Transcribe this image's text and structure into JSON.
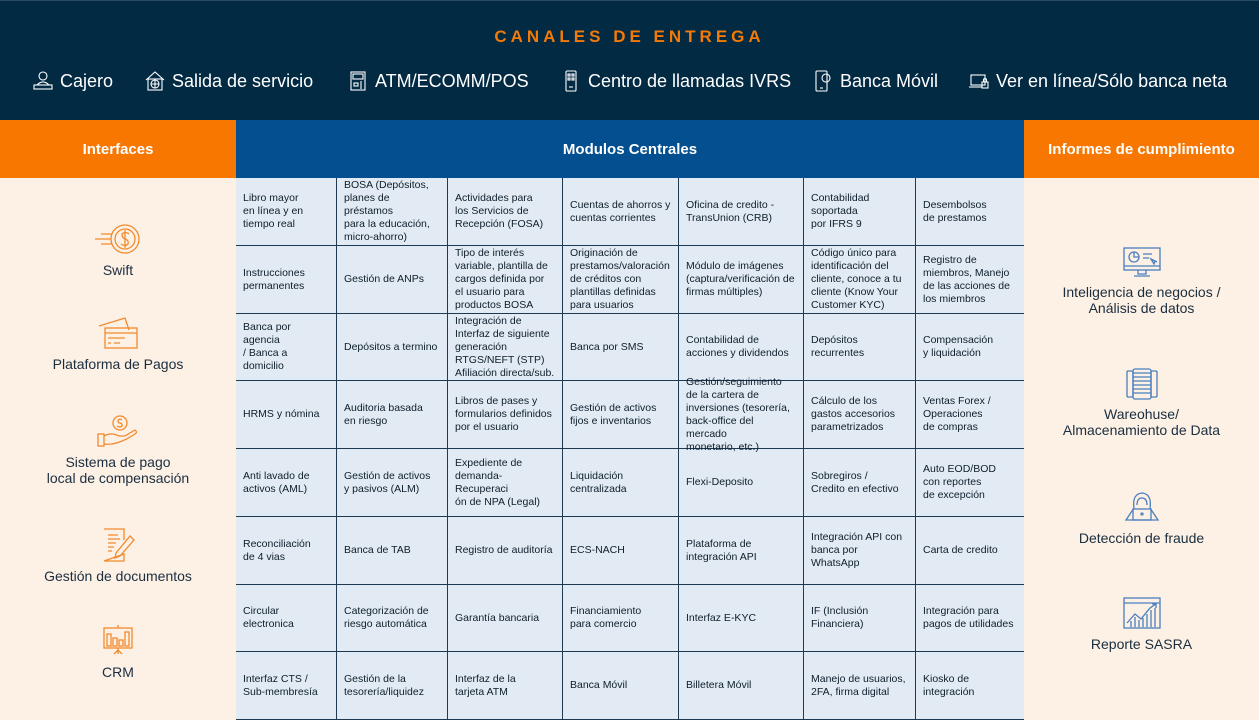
{
  "header": {
    "title": "CANALES DE ENTREGA",
    "channels": [
      {
        "label": "Cajero",
        "icon": "cashier-icon"
      },
      {
        "label": "Salida de servicio",
        "icon": "service-outlet-icon"
      },
      {
        "label": "ATM/ECOMM/POS",
        "icon": "atm-icon"
      },
      {
        "label": "Centro de llamadas IVRS",
        "icon": "phone-keypad-icon"
      },
      {
        "label": "Banca Móvil",
        "icon": "mobile-banking-icon"
      },
      {
        "label": "Ver en línea/Sólo banca neta",
        "icon": "laptop-lock-icon"
      }
    ]
  },
  "columns": {
    "left": "Interfaces",
    "middle": "Modulos Centrales",
    "right": "Informes de cumplimiento"
  },
  "interfaces": [
    {
      "label": "Swift",
      "icon": "coin-speed-icon"
    },
    {
      "label": "Plataforma de Pagos",
      "icon": "credit-cards-icon"
    },
    {
      "label": "Sistema de pago\nlocal de compensación",
      "icon": "hand-coin-icon"
    },
    {
      "label": "Gestión de documentos",
      "icon": "document-pencil-icon"
    },
    {
      "label": "CRM",
      "icon": "presentation-chart-icon"
    }
  ],
  "compliance": [
    {
      "label": "Inteligencia de negocios /\nAnálisis de datos",
      "icon": "monitor-pie-chart-icon"
    },
    {
      "label": "Wareohuse/\nAlmacenamiento de Data",
      "icon": "server-rack-icon"
    },
    {
      "label": "Detección de fraude",
      "icon": "hacker-laptop-icon"
    },
    {
      "label": "Reporte SASRA",
      "icon": "growth-chart-icon"
    }
  ],
  "modules": [
    [
      "Libro mayor\nen línea y en\ntiempo real",
      "BOSA (Depósitos,\nplanes de préstamos\npara la educación,\nmicro-ahorro)",
      "Actividades para\nlos Servicios de\nRecepción (FOSA)",
      "Cuentas de ahorros y\ncuentas corrientes",
      "Oficina de credito -\nTransUnion (CRB)",
      "Contabilidad\nsoportada\npor IFRS 9",
      "Desembolsos\nde prestamos"
    ],
    [
      "Instrucciones\npermanentes",
      "Gestión de ANPs",
      "Tipo de interés\nvariable, plantilla de\ncargos definida por\nel usuario para\nproductos BOSA",
      "Originación de\nprestamos/valoración\nde créditos con\nplantillas definidas\npara usuarios",
      "Módulo de imágenes\n(captura/verificación de\nfirmas múltiples)",
      "Código único para\nidentificación del\ncliente, conoce a tu\ncliente (Know Your\nCustomer KYC)",
      "Registro de\nmiembros, Manejo\nde las acciones de\nlos miembros"
    ],
    [
      "Banca por agencia\n/ Banca a domicilio",
      "Depósitos a termino",
      "Integración de\nInterfaz de siguiente\ngeneración\nRTGS/NEFT (STP)\nAfiliación directa/sub.",
      "Banca por SMS",
      "Contabilidad de\nacciones y dividendos",
      "Depósitos\nrecurrentes",
      "Compensación\ny liquidación"
    ],
    [
      "HRMS y nómina",
      "Auditoria basada\nen riesgo",
      "Libros de pases y\nformularios definidos\npor el usuario",
      "Gestión de activos\nfijos e inventarios",
      "Gestión/seguimiento\nde la cartera de\ninversiones (tesorería,\nback-office del mercado\nmonetario, etc.)",
      "Cálculo de los\ngastos accesorios\nparametrizados",
      "Ventas Forex /\nOperaciones\nde compras"
    ],
    [
      "Anti lavado de\nactivos (AML)",
      "Gestión de activos\ny pasivos (ALM)",
      "Expediente de\ndemanda-Recuperaci\nón de NPA (Legal)",
      "Liquidación\ncentralizada",
      "Flexi-Deposito",
      "Sobregiros /\nCredito en efectivo",
      "Auto EOD/BOD\ncon reportes\nde excepción"
    ],
    [
      "Reconciliación\nde 4 vias",
      "Banca de TAB",
      "Registro de auditoría",
      "ECS-NACH",
      "Plataforma de\nintegración API",
      "Integración API con\nbanca por WhatsApp",
      "Carta de credito"
    ],
    [
      "Circular\nelectronica",
      "Categorización de\nriesgo automática",
      "Garantía bancaria",
      "Financiamiento\npara comercio",
      "Interfaz E-KYC",
      "IF (Inclusión\nFinanciera)",
      "Integración para\npagos de utilidades"
    ],
    [
      "Interfaz CTS /\nSub-membresía",
      "Gestión de la\ntesorería/liquidez",
      "Interfaz de la\ntarjeta ATM",
      "Banca Móvil",
      "Billetera Móvil",
      "Manejo de usuarios,\n2FA, firma digital",
      "Kiosko de\nintegración"
    ]
  ],
  "colors": {
    "navy": "#022a43",
    "orange": "#f77700",
    "title_orange": "#f47a07",
    "blue": "#044f8f",
    "grid_bg": "#e2ebf3",
    "side_bg": "#fdf0e4",
    "icon_orange": "#f28a2e",
    "icon_blue": "#4a7fbf"
  }
}
